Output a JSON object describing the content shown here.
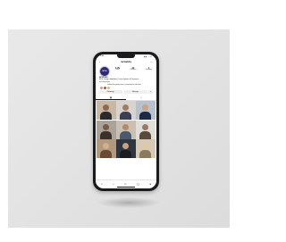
{
  "status_bar": {
    "time": "9:41",
    "icons": "▮▮ ◔ ▭"
  },
  "profile": {
    "username": "mcwebby",
    "avatar_text": "MCW",
    "stats": [
      {
        "value": "1.2k",
        "label": "Posts"
      },
      {
        "value": "4k",
        "label": "Followers"
      },
      {
        "value": "1",
        "label": "Following"
      }
    ],
    "bio_name": "MCW Web",
    "bio_lines": [
      "MCW Designs Highlights | Latest Updates &",
      "Resources"
    ],
    "bio_link": "mcw.dsgn/links",
    "followed_by": "Followed by quality.sweep, crowsnotspace and others"
  },
  "buttons": {
    "follow": "Following ▾",
    "message": "Message",
    "more": "▾"
  },
  "tabs": {
    "grid": "▦",
    "tagged": "◻"
  },
  "nav": {
    "home": "⌂",
    "search": "⌕",
    "reels": "▷",
    "shop": "◻",
    "profile": "●"
  },
  "colors": {
    "avatar_bg": "#2f2a6e",
    "tiles": [
      {
        "bg": "#c9b8a6",
        "head": "#8a6a52",
        "body": "#2b2b2b"
      },
      {
        "bg": "#d8d3cc",
        "head": "#a07e66",
        "body": "#3a3f52"
      },
      {
        "bg": "#b9c2cc",
        "head": "#caa284",
        "body": "#1e2a44"
      },
      {
        "bg": "#a9a39a",
        "head": "#7a5b46",
        "body": "#3d2f2a"
      },
      {
        "bg": "#cbbfb1",
        "head": "#b48a6c",
        "body": "#4a5a6a"
      },
      {
        "bg": "#e0ded8",
        "head": "#9a7a64",
        "body": "#5a4a3c"
      },
      {
        "bg": "#b19a7e",
        "head": "#d1b08a",
        "body": "#6a4a34"
      },
      {
        "bg": "#2f3640",
        "head": "#c6a283",
        "body": "#1a1d22"
      },
      {
        "bg": "#d6c9b6",
        "head": "#e3c7a0",
        "body": "#8c7a5c"
      }
    ],
    "faces": [
      "#c7a48a",
      "#7d6a60",
      "#d9b79a"
    ]
  }
}
